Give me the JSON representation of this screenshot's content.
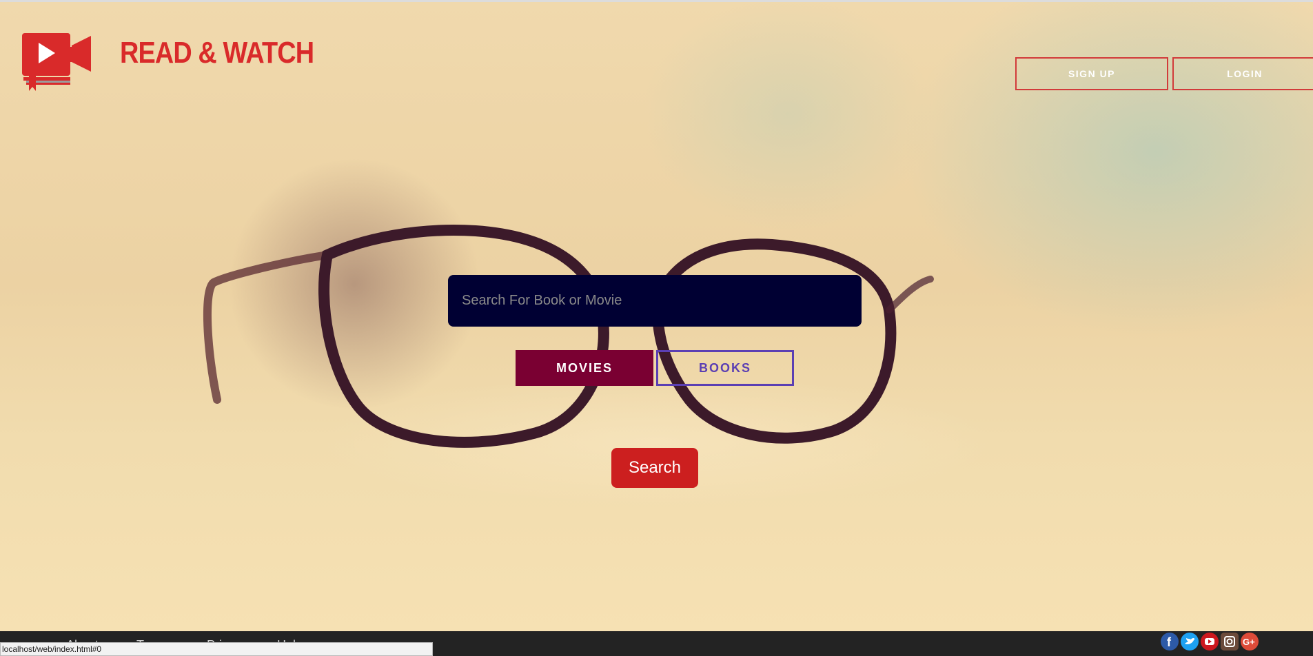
{
  "brand": {
    "name": "READ & WATCH",
    "logo_icon": "book-video-camera-icon"
  },
  "header": {
    "signup_label": "SIGN UP",
    "login_label": "LOGIN"
  },
  "search": {
    "placeholder": "Search For Book or Movie",
    "value": ""
  },
  "mode_toggle": {
    "movies_label": "MOVIES",
    "books_label": "BOOKS",
    "selected": "MOVIES"
  },
  "search_button_label": "Search",
  "footer": {
    "links": [
      "About",
      "Terms",
      "Privacy",
      "Help"
    ],
    "social_icons": [
      "facebook-icon",
      "twitter-icon",
      "youtube-icon",
      "instagram-icon",
      "google-plus-icon"
    ]
  },
  "status_bar": {
    "url": "localhost/web/index.html#0"
  },
  "colors": {
    "brand_red": "#d92a2a",
    "search_bg": "#000033",
    "movies_bg": "#7a0032",
    "books_accent": "#5b3fb3",
    "search_button": "#cc1f1f",
    "footer_bg": "#232323"
  }
}
